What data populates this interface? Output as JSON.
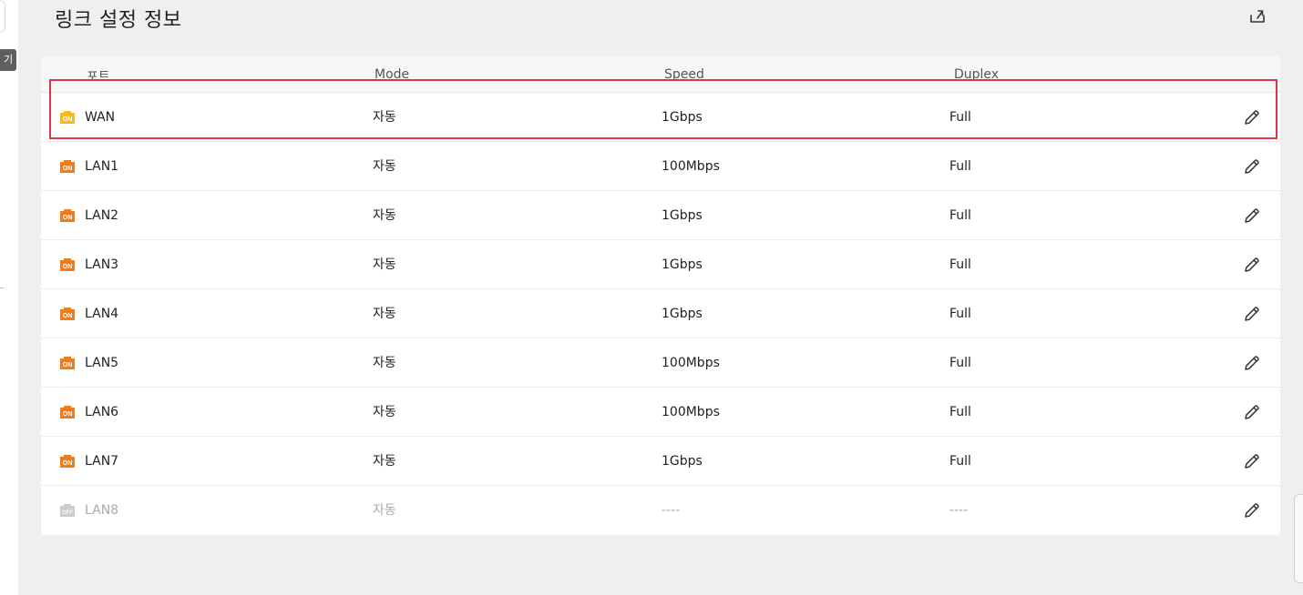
{
  "sidebar": {
    "tooltip_label": "기"
  },
  "header": {
    "title": "링크 설정 정보",
    "export_icon": "export-icon"
  },
  "table": {
    "columns": [
      "포트",
      "Mode",
      "Speed",
      "Duplex"
    ],
    "rows": [
      {
        "port": "WAN",
        "status_icon": "on-yellow",
        "mode": "자동",
        "speed": "1Gbps",
        "duplex": "Full"
      },
      {
        "port": "LAN1",
        "status_icon": "on-orange",
        "mode": "자동",
        "speed": "100Mbps",
        "duplex": "Full"
      },
      {
        "port": "LAN2",
        "status_icon": "on-orange",
        "mode": "자동",
        "speed": "1Gbps",
        "duplex": "Full"
      },
      {
        "port": "LAN3",
        "status_icon": "on-orange",
        "mode": "자동",
        "speed": "1Gbps",
        "duplex": "Full"
      },
      {
        "port": "LAN4",
        "status_icon": "on-orange",
        "mode": "자동",
        "speed": "1Gbps",
        "duplex": "Full"
      },
      {
        "port": "LAN5",
        "status_icon": "on-orange",
        "mode": "자동",
        "speed": "100Mbps",
        "duplex": "Full"
      },
      {
        "port": "LAN6",
        "status_icon": "on-orange",
        "mode": "자동",
        "speed": "100Mbps",
        "duplex": "Full"
      },
      {
        "port": "LAN7",
        "status_icon": "on-orange",
        "mode": "자동",
        "speed": "1Gbps",
        "duplex": "Full"
      },
      {
        "port": "LAN8",
        "status_icon": "off-gray",
        "mode": "자동",
        "speed": "----",
        "duplex": "----"
      }
    ]
  },
  "colors": {
    "on_yellow": "#f7b924",
    "on_orange": "#ee7d1e",
    "off_gray": "#cccccc",
    "highlight": "#e53343"
  },
  "icon_labels": {
    "on": "ON",
    "off": "OFF"
  }
}
